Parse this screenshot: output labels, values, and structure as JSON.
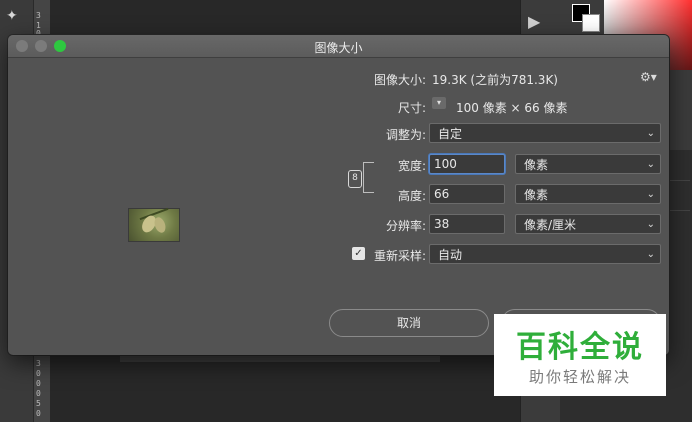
{
  "background": {
    "ruler_numbers": [
      "3",
      "1",
      "0",
      "3",
      "0",
      "0",
      "0",
      "3",
      "5",
      "0",
      "0"
    ]
  },
  "dialog": {
    "title": "图像大小",
    "image_size_label": "图像大小:",
    "image_size_value": "19.3K (之前为781.3K)",
    "dimensions_label": "尺寸:",
    "dimensions_value": "100 像素  ×  66 像素",
    "fit_to_label": "调整为:",
    "fit_to_value": "自定",
    "width_label": "宽度:",
    "width_value": "100",
    "width_unit": "像素",
    "height_label": "高度:",
    "height_value": "66",
    "height_unit": "像素",
    "resolution_label": "分辨率:",
    "resolution_value": "38",
    "resolution_unit": "像素/厘米",
    "resample_label": "重新采样:",
    "resample_checked": true,
    "resample_value": "自动",
    "cancel_label": "取消"
  },
  "watermark": {
    "title": "百科全说",
    "subtitle": "助你轻松解决"
  }
}
